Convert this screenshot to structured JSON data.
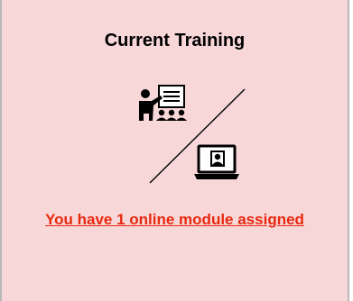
{
  "card": {
    "title": "Current Training",
    "link_text": "You have 1 online module assigned",
    "icons": [
      "in-person-training-icon",
      "online-training-laptop-icon"
    ]
  },
  "colors": {
    "card_background": "#f8d7d8",
    "link": "#e8280f",
    "title": "#000000",
    "border": "#b9b9b9"
  }
}
